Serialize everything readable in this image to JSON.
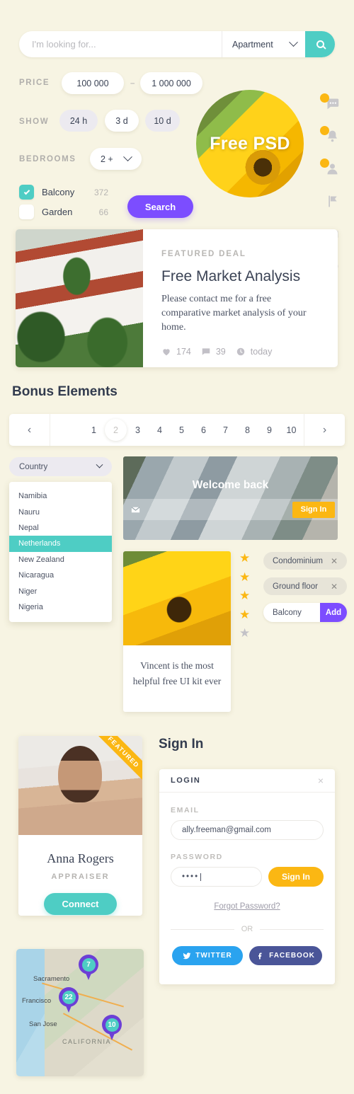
{
  "search": {
    "placeholder": "I'm looking for...",
    "type_value": "Apartment",
    "search_icon": "search-icon"
  },
  "filters": {
    "price_label": "PRICE",
    "price_min": "100 000",
    "price_sep": "–",
    "price_max": "1 000 000",
    "show_label": "SHOW",
    "show_options": [
      "24 h",
      "3 d",
      "10 d"
    ],
    "show_active_index": 1,
    "bedrooms_label": "BEDROOMS",
    "bedrooms_value": "2 +",
    "checkboxes": [
      {
        "label": "Balcony",
        "count": "372",
        "checked": true
      },
      {
        "label": "Garden",
        "count": "66",
        "checked": false
      }
    ],
    "search_button": "Search"
  },
  "promo": {
    "badge_text": "Free PSD"
  },
  "side_icons": [
    {
      "name": "chat-icon",
      "glyph": "💬",
      "has_dot": true
    },
    {
      "name": "bell-icon",
      "glyph": "🔔",
      "has_dot": true
    },
    {
      "name": "user-icon",
      "glyph": "👤",
      "has_dot": true
    },
    {
      "name": "flag-icon",
      "glyph": "⚑",
      "has_dot": false
    },
    {
      "name": "envelope-icon",
      "glyph": "✉",
      "has_dot": false
    },
    {
      "name": "clock-icon",
      "glyph": "🕐",
      "has_dot": false
    }
  ],
  "deal": {
    "kicker": "FEATURED DEAL",
    "title": "Free Market Analysis",
    "description": "Please contact me for a free comparative market analysis of your home.",
    "likes": "174",
    "comments": "39",
    "time": "today"
  },
  "bonus": {
    "section_title": "Bonus Elements"
  },
  "pagination": {
    "prev": "‹",
    "next": "›",
    "pages": [
      "1",
      "2",
      "3",
      "4",
      "5",
      "6",
      "7",
      "8",
      "9",
      "10"
    ],
    "current": "2"
  },
  "country_select": {
    "trigger_label": "Country",
    "options": [
      "Namibia",
      "Nauru",
      "Nepal",
      "Netherlands",
      "New Zealand",
      "Nicaragua",
      "Niger",
      "Nigeria"
    ],
    "selected": "Netherlands"
  },
  "welcome": {
    "title": "Welcome back",
    "signin_button": "Sign In",
    "envelope_icon": "envelope-icon"
  },
  "testimonial": {
    "text": "Vincent is the most helpful free UI kit ever"
  },
  "rating": {
    "filled": 4,
    "total": 5
  },
  "tags": {
    "items": [
      {
        "label": "Condominium",
        "remove": "✕"
      },
      {
        "label": "Ground floor",
        "remove": "✕"
      }
    ],
    "input_value": "Balcony",
    "add_button": "Add"
  },
  "profile": {
    "ribbon": "FEATURED",
    "name": "Anna Rogers",
    "role": "APPRAISER",
    "action": "Connect"
  },
  "signin": {
    "heading": "Sign In",
    "panel_title": "LOGIN",
    "close": "×",
    "email_label": "EMAIL",
    "email_value": "ally.freeman@gmail.com",
    "password_label": "PASSWORD",
    "password_value": "••••",
    "submit": "Sign In",
    "forgot": "Forgot Password?",
    "or": "OR",
    "twitter": "TWITTER",
    "facebook": "FACEBOOK"
  },
  "map": {
    "cities": [
      "Sacramento",
      "Francisco",
      "San Jose"
    ],
    "state": "CALIFORNIA",
    "pins": [
      {
        "count": "7"
      },
      {
        "count": "22"
      },
      {
        "count": "10"
      }
    ]
  },
  "colors": {
    "background": "#f7f4e3",
    "teal": "#4ecdc4",
    "purple": "#7c4dff",
    "amber": "#fbb713",
    "dark": "#3b4355",
    "twitter_blue": "#2aa3ef",
    "facebook_blue": "#4a5598",
    "pin_purple": "#6c3fd6"
  }
}
